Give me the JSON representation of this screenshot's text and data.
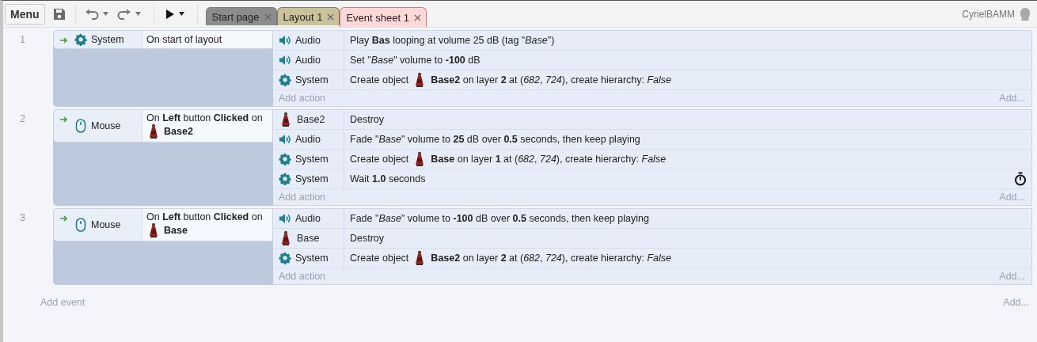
{
  "toolbar": {
    "menu": "Menu"
  },
  "tabs": [
    {
      "label": "Start page",
      "color": "#8c8c8c",
      "selected": false
    },
    {
      "label": "Layout 1",
      "color": "#cbc29c",
      "selected": false
    },
    {
      "label": "Event sheet 1",
      "color": "#ffd9d9",
      "selected": true
    }
  ],
  "user": {
    "name": "CyrielBAMM"
  },
  "events": [
    {
      "number": "1",
      "condition": {
        "object": "System",
        "kind": "gear",
        "parts": [
          {
            "kind": "text",
            "text": "On start of layout"
          }
        ]
      },
      "actions": [
        {
          "object": "Audio",
          "kind": "speaker",
          "parts": [
            {
              "kind": "text",
              "text": "Play **Bas** looping at volume 25 dB (tag \"*Base*\")"
            }
          ]
        },
        {
          "object": "Audio",
          "kind": "speaker",
          "parts": [
            {
              "kind": "text",
              "text": "Set \"*Base*\" volume to **-100** dB"
            }
          ]
        },
        {
          "object": "System",
          "kind": "gear",
          "parts": [
            {
              "kind": "text",
              "text": "Create object"
            },
            {
              "kind": "sprite"
            },
            {
              "kind": "text",
              "text": "**Base2** on layer **2** at (*682*, *724*), create hierarchy: *False*"
            }
          ]
        }
      ],
      "add_action": "Add action",
      "add_more": "Add..."
    },
    {
      "number": "2",
      "condition": {
        "object": "Mouse",
        "kind": "mouse",
        "parts": [
          {
            "kind": "text",
            "text": "On **Left** button **Clicked** on"
          },
          {
            "kind": "sprite"
          },
          {
            "kind": "text",
            "text": "**Base2**"
          }
        ]
      },
      "actions": [
        {
          "object": "Base2",
          "kind": "sprite",
          "parts": [
            {
              "kind": "text",
              "text": "Destroy"
            }
          ]
        },
        {
          "object": "Audio",
          "kind": "speaker",
          "parts": [
            {
              "kind": "text",
              "text": "Fade \"*Base*\" volume to **25** dB over **0.5** seconds, then keep playing"
            }
          ]
        },
        {
          "object": "System",
          "kind": "gear",
          "parts": [
            {
              "kind": "text",
              "text": "Create object"
            },
            {
              "kind": "sprite"
            },
            {
              "kind": "text",
              "text": "**Base** on layer **1** at (*682*, *724*), create hierarchy: *False*"
            }
          ]
        },
        {
          "object": "System",
          "kind": "gear",
          "timer": true,
          "parts": [
            {
              "kind": "text",
              "text": "Wait **1.0** seconds"
            }
          ]
        }
      ],
      "add_action": "Add action",
      "add_more": "Add..."
    },
    {
      "number": "3",
      "condition": {
        "object": "Mouse",
        "kind": "mouse",
        "parts": [
          {
            "kind": "text",
            "text": "On **Left** button **Clicked** on"
          },
          {
            "kind": "sprite"
          },
          {
            "kind": "text",
            "text": "**Base**"
          }
        ]
      },
      "actions": [
        {
          "object": "Audio",
          "kind": "speaker",
          "parts": [
            {
              "kind": "text",
              "text": "Fade \"*Base*\" volume to **-100** dB over **0.5** seconds, then keep playing"
            }
          ]
        },
        {
          "object": "Base",
          "kind": "sprite",
          "parts": [
            {
              "kind": "text",
              "text": "Destroy"
            }
          ]
        },
        {
          "object": "System",
          "kind": "gear",
          "parts": [
            {
              "kind": "text",
              "text": "Create object"
            },
            {
              "kind": "sprite"
            },
            {
              "kind": "text",
              "text": "**Base2** on layer **2** at (*682*, *724*), create hierarchy: *False*"
            }
          ]
        }
      ],
      "add_action": "Add action",
      "add_more": "Add..."
    }
  ],
  "add_event": "Add event",
  "add_event_more": "Add..."
}
